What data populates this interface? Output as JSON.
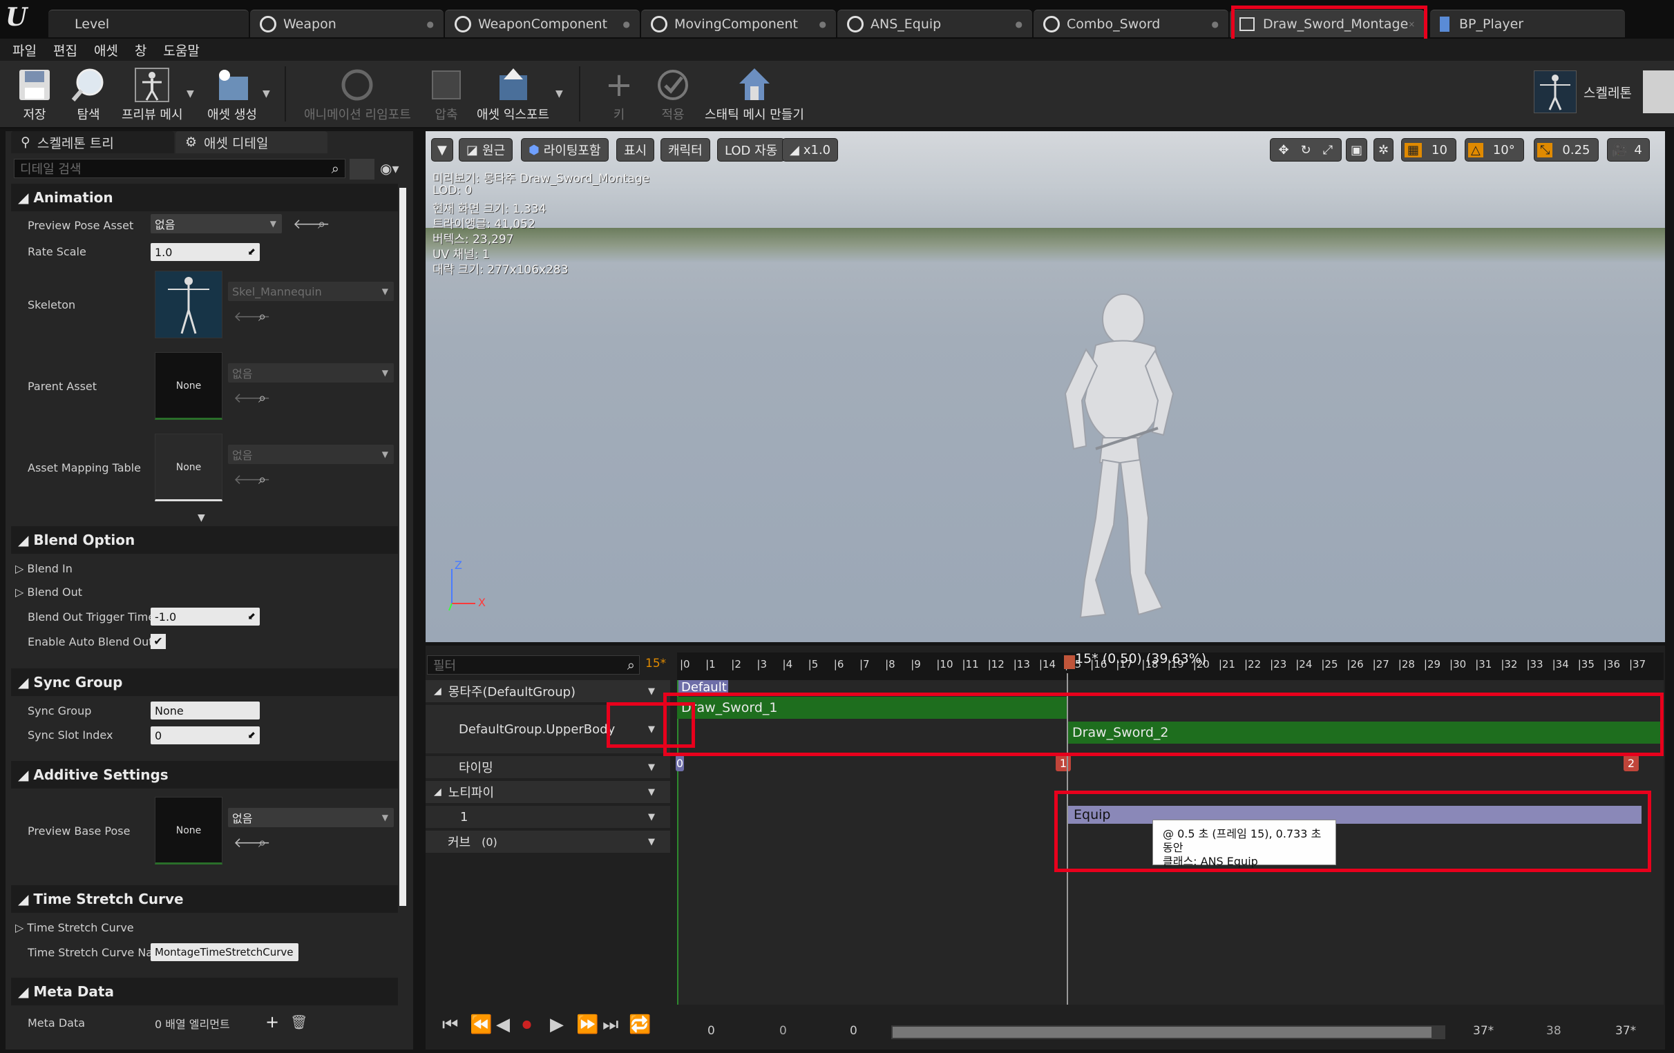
{
  "tabs": [
    {
      "label": "Level",
      "icon": "level-icon"
    },
    {
      "label": "Weapon",
      "icon": "blueprint-icon"
    },
    {
      "label": "WeaponComponent",
      "icon": "blueprint-icon"
    },
    {
      "label": "MovingComponent",
      "icon": "blueprint-icon"
    },
    {
      "label": "ANS_Equip",
      "icon": "blueprint-icon"
    },
    {
      "label": "Combo_Sword",
      "icon": "blueprint-icon"
    },
    {
      "label": "Draw_Sword_Montage",
      "icon": "montage-icon"
    },
    {
      "label": "BP_Player",
      "icon": "blueprint-icon"
    }
  ],
  "menu": [
    "파일",
    "편집",
    "애셋",
    "창",
    "도움말"
  ],
  "toolbar": {
    "save": "저장",
    "browse": "탐색",
    "preview_mesh": "프리뷰 메시",
    "create_asset": "애셋 생성",
    "reimport": "애니메이션 리임포트",
    "compress": "압축",
    "export_asset": "애셋 익스포트",
    "key": "키",
    "apply": "적용",
    "make_static_mesh": "스태틱 메시 만들기",
    "skeleton": "스켈레톤"
  },
  "left": {
    "tab_skeleton_tree": "스켈레톤 트리",
    "tab_asset_details": "애셋 디테일",
    "search_placeholder": "디테일 검색",
    "animation": {
      "title": "Animation",
      "preview_pose_asset": "Preview Pose Asset",
      "preview_pose_value": "없음",
      "rate_scale": "Rate Scale",
      "rate_scale_value": "1.0",
      "skeleton": "Skeleton",
      "skeleton_value": "Skel_Mannequin",
      "parent_asset": "Parent Asset",
      "parent_asset_value": "없음",
      "asset_mapping": "Asset Mapping Table",
      "asset_mapping_value": "없음",
      "none": "None"
    },
    "blend": {
      "title": "Blend Option",
      "blend_in": "Blend In",
      "blend_out": "Blend Out",
      "trigger": "Blend Out Trigger Time",
      "trigger_value": "-1.0",
      "auto": "Enable Auto Blend Out"
    },
    "sync": {
      "title": "Sync Group",
      "group": "Sync Group",
      "group_value": "None",
      "slot": "Sync Slot Index",
      "slot_value": "0"
    },
    "additive": {
      "title": "Additive Settings",
      "base_pose": "Preview Base Pose",
      "base_pose_value": "없음"
    },
    "time_stretch": {
      "title": "Time Stretch Curve",
      "curve": "Time Stretch Curve",
      "curve_name": "Time Stretch Curve Nam",
      "curve_name_value": "MontageTimeStretchCurve"
    },
    "meta": {
      "title": "Meta Data",
      "label": "Meta Data",
      "value": "0 배열 엘리먼트"
    }
  },
  "viewport": {
    "buttons": [
      "원근",
      "라이팅포함",
      "표시",
      "캐릭터",
      "LOD 자동",
      "x1.0"
    ],
    "info": [
      "미리보기: 몽타주 Draw_Sword_Montage",
      "LOD: 0",
      "현재 화면 크기: 1.334",
      "트라이앵글: 41,052",
      "버텍스: 23,297",
      "UV 채널: 1",
      "대략 크기: 277x106x283"
    ],
    "grid": "10",
    "rot": "10°",
    "scale": "0.25",
    "cam": "4"
  },
  "timeline": {
    "filter_placeholder": "필터",
    "frame_indicator": "15*",
    "playhead_label": "15* (0.50) (39.63%)",
    "ticks": [
      "0",
      "1",
      "2",
      "3",
      "4",
      "5",
      "6",
      "7",
      "8",
      "9",
      "10",
      "11",
      "12",
      "13",
      "14",
      "15",
      "16",
      "17",
      "18",
      "19",
      "20",
      "21",
      "22",
      "23",
      "24",
      "25",
      "26",
      "27",
      "28",
      "29",
      "30",
      "31",
      "32",
      "33",
      "34",
      "35",
      "36",
      "37"
    ],
    "montage_group": "몽타주(DefaultGroup)",
    "section_default": "Default",
    "slot_prefix": "DefaultGrou",
    "slot_suffix": "p.UpperBody",
    "clip1": "Draw_Sword_1",
    "clip2": "Draw_Sword_2",
    "timing": "타이밍",
    "markers": [
      "0",
      "1",
      "2"
    ],
    "notifies": "노티파이",
    "notify_track": "1",
    "notify_name": "Equip",
    "curves": "커브",
    "curves_count": "(0)",
    "tooltip_line1": "@ 0.5 초 (프레임 15), 0.733 초동안",
    "tooltip_line2": "클래스: ANS Equip",
    "bottom_nums": [
      "0",
      "0",
      "0",
      "37*",
      "38",
      "37*"
    ]
  }
}
